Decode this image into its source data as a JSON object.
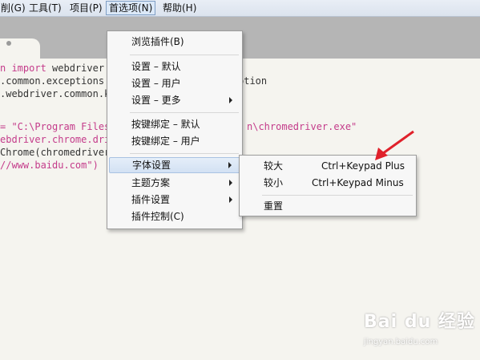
{
  "menubar": {
    "items": [
      "削(G)",
      "工具(T)",
      "项目(P)",
      "首选项(N)",
      "帮助(H)"
    ]
  },
  "code": {
    "lines": [
      {
        "parts": [
          {
            "t": "n ",
            "c": "kw"
          },
          {
            "t": "import",
            "c": "kw"
          },
          {
            "t": " webdriver",
            "c": ""
          }
        ]
      },
      {
        "parts": [
          {
            "t": ".common.exceptions",
            "c": ""
          }
        ]
      },
      {
        "parts": [
          {
            "t": ".webdriver.common.k",
            "c": ""
          }
        ]
      },
      {
        "parts": []
      },
      {
        "parts": [
          {
            "t": "= \"C:\\Program Files",
            "c": "str"
          }
        ]
      },
      {
        "parts": [
          {
            "t": "ebdriver.chrome.dri",
            "c": "kw"
          }
        ]
      },
      {
        "parts": [
          {
            "t": "Chrome(chromedriver",
            "c": ""
          }
        ]
      },
      {
        "parts": [
          {
            "t": "//www.baidu.com\")",
            "c": "str"
          }
        ]
      }
    ],
    "right_fragments": [
      "ption",
      "n\\chromedriver.exe\""
    ]
  },
  "preferences_menu": {
    "items": [
      {
        "label": "浏览插件(B)"
      },
      {
        "label": "设置 – 默认"
      },
      {
        "label": "设置 – 用户"
      },
      {
        "label": "设置 – 更多",
        "submenu": true
      },
      {
        "label": "按键绑定 – 默认"
      },
      {
        "label": "按键绑定 – 用户"
      },
      {
        "label": "字体设置",
        "submenu": true,
        "highlight": true
      },
      {
        "label": "主题方案",
        "submenu": true
      },
      {
        "label": "插件设置",
        "submenu": true
      },
      {
        "label": "插件控制(C)"
      }
    ]
  },
  "font_submenu": {
    "items": [
      {
        "label": "较大",
        "shortcut": "Ctrl+Keypad Plus"
      },
      {
        "label": "较小",
        "shortcut": "Ctrl+Keypad Minus"
      },
      {
        "label": "重置",
        "shortcut": ""
      }
    ]
  },
  "watermark": {
    "line1": "Bai du 经验",
    "line2": "jingyan.baidu.com"
  },
  "colors": {
    "accent_red": "#e0212b",
    "keyword": "#c43b8a"
  }
}
